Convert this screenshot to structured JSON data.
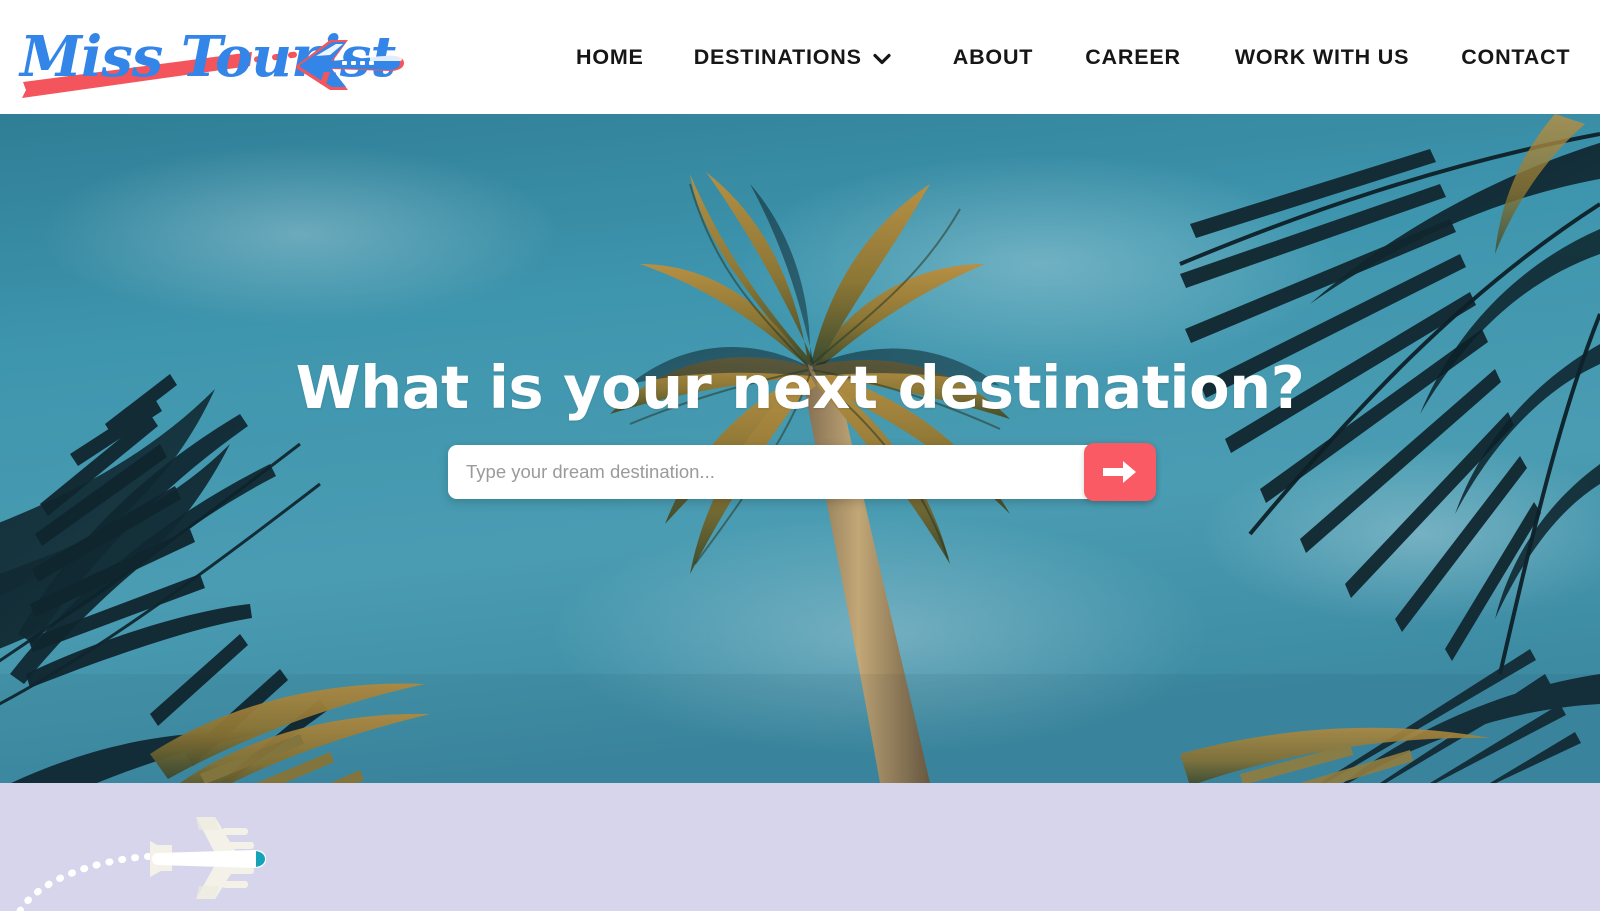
{
  "site": {
    "brand_name": "Miss Tourist",
    "brand_blue": "#3385e8",
    "brand_red": "#f4555c"
  },
  "header": {
    "logo_alt": "Miss Tourist",
    "nav": [
      {
        "label": "HOME",
        "has_dropdown": false
      },
      {
        "label": "DESTINATIONS",
        "has_dropdown": true
      },
      {
        "label": "ABOUT",
        "has_dropdown": false
      },
      {
        "label": "CAREER",
        "has_dropdown": false
      },
      {
        "label": "WORK WITH US",
        "has_dropdown": false
      },
      {
        "label": "CONTACT",
        "has_dropdown": false
      }
    ],
    "dropdown_icon": "chevron-down-icon"
  },
  "hero": {
    "title": "What is your next destination?",
    "background_description": "Palm trees against a teal blue sky",
    "background_sky_color": "#3e8ca4",
    "search": {
      "placeholder": "Type your dream destination...",
      "value": "",
      "submit_icon": "arrow-right-icon",
      "submit_color": "#fa5a63"
    }
  },
  "lower_section": {
    "background_color": "#d6d5ec",
    "decoration_icon": "airplane-icon",
    "decoration_description": "White airplane with dotted flight trail"
  }
}
